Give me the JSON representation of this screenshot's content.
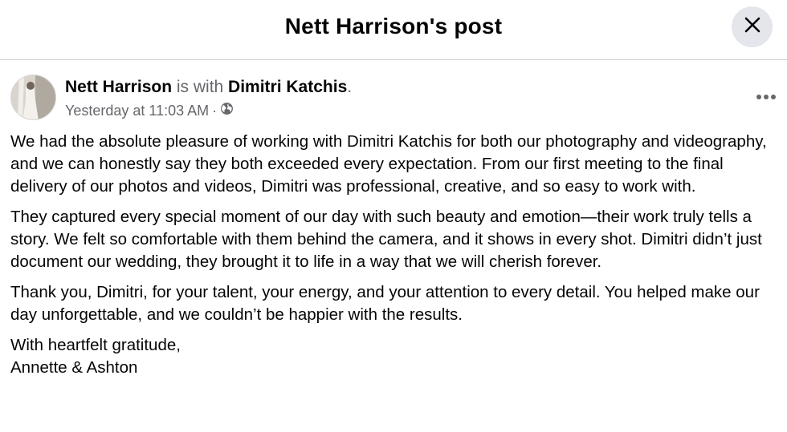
{
  "header": {
    "title": "Nett Harrison's post",
    "close_icon": "close-icon"
  },
  "post": {
    "author": "Nett Harrison",
    "with_text": " is with ",
    "tagged": "Dimitri Katchis",
    "period": ".",
    "timestamp": "Yesterday at 11:03 AM",
    "separator": "·",
    "audience_icon": "globe-icon",
    "more_icon": "more-horizontal-icon",
    "paragraphs": [
      "We had the absolute pleasure of working with Dimitri Katchis for both our photography and videography, and we can honestly say they both exceeded every expectation. From our first meeting to the final delivery of our photos and videos, Dimitri was professional, creative, and so easy to work with.",
      "They captured every special moment of our day with such beauty and emotion—their work truly tells a story. We felt so comfortable with them  behind the camera, and it shows in every shot. Dimitri didn’t just document our wedding, they brought it to life in a way that we will cherish forever.",
      "Thank you, Dimitri, for your talent, your energy, and your attention to every detail. You helped make our day unforgettable, and we couldn’t be happier with the results."
    ],
    "signoff_line1": "With heartfelt gratitude,",
    "signoff_line2": "Annette & Ashton"
  }
}
